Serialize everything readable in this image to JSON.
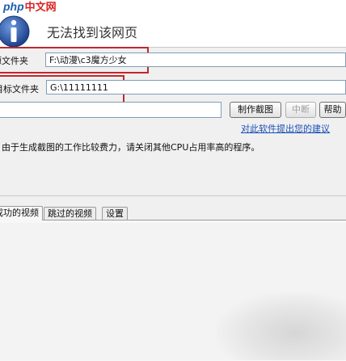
{
  "watermark": {
    "php": "php",
    "cn": "中文网"
  },
  "header": {
    "title": "无法找到该网页"
  },
  "source": {
    "label": "源文件夹",
    "value": "F:\\动漫\\c3魔方少女"
  },
  "target": {
    "label": "目标文件夹",
    "value": "G:\\11111111"
  },
  "toolbar": {
    "make_label": "制作截图",
    "pause_label": "中断",
    "help_label": "帮助",
    "feedback_link": "对此软件提出您的建议"
  },
  "status_note": "由于生成截图的工作比较费力，请关闭其他CPU占用率高的程序。",
  "tabs": [
    {
      "label": "成功的视频"
    },
    {
      "label": "跳过的视频"
    },
    {
      "label": "设置"
    }
  ],
  "colors": {
    "highlight": "#c0282c",
    "link": "#1a4fb5",
    "brand_blue": "#1f5fb0"
  }
}
